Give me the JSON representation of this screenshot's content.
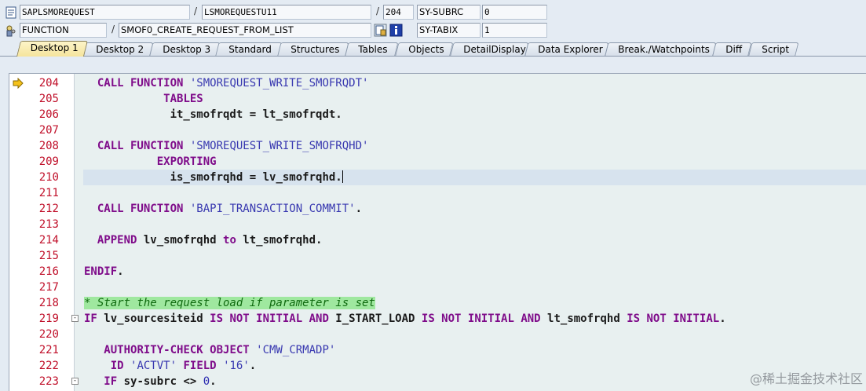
{
  "header": {
    "program": "SAPLSMOREQUEST",
    "include": "LSMOREQUESTU11",
    "line": "204",
    "sy_subrc_label": "SY-SUBRC",
    "sy_subrc_value": "0",
    "event_type": "FUNCTION",
    "event_name": "SMOF0_CREATE_REQUEST_FROM_LIST",
    "sy_tabix_label": "SY-TABIX",
    "sy_tabix_value": "1",
    "separator": "/"
  },
  "tabs": [
    {
      "label": "Desktop 1",
      "active": true
    },
    {
      "label": "Desktop 2"
    },
    {
      "label": "Desktop 3"
    },
    {
      "label": "Standard"
    },
    {
      "label": "Structures"
    },
    {
      "label": "Tables"
    },
    {
      "label": "Objects"
    },
    {
      "label": "DetailDisplay"
    },
    {
      "label": "Data Explorer"
    },
    {
      "label": "Break./Watchpoints"
    },
    {
      "label": "Diff"
    },
    {
      "label": "Script"
    }
  ],
  "editor": {
    "current_line": "204",
    "cursor_line": "210",
    "lines": [
      {
        "n": "204",
        "indent": "  ",
        "parts": [
          [
            "kw",
            "CALL FUNCTION"
          ],
          [
            "id",
            " "
          ],
          [
            "str",
            "'SMOREQUEST_WRITE_SMOFRQDT'"
          ]
        ]
      },
      {
        "n": "205",
        "indent": "            ",
        "parts": [
          [
            "kw",
            "TABLES"
          ]
        ]
      },
      {
        "n": "206",
        "indent": "             ",
        "parts": [
          [
            "id",
            "it_smofrqdt = lt_smofrqdt."
          ]
        ]
      },
      {
        "n": "207",
        "indent": "",
        "parts": []
      },
      {
        "n": "208",
        "indent": "  ",
        "parts": [
          [
            "kw",
            "CALL FUNCTION"
          ],
          [
            "id",
            " "
          ],
          [
            "str",
            "'SMOREQUEST_WRITE_SMOFRQHD'"
          ]
        ]
      },
      {
        "n": "209",
        "indent": "           ",
        "parts": [
          [
            "kw",
            "EXPORTING"
          ]
        ]
      },
      {
        "n": "210",
        "indent": "             ",
        "parts": [
          [
            "id",
            "is_smofrqhd = lv_smofrqhd."
          ]
        ]
      },
      {
        "n": "211",
        "indent": "",
        "parts": []
      },
      {
        "n": "212",
        "indent": "  ",
        "parts": [
          [
            "kw",
            "CALL FUNCTION"
          ],
          [
            "id",
            " "
          ],
          [
            "str",
            "'BAPI_TRANSACTION_COMMIT'"
          ],
          [
            "id",
            "."
          ]
        ]
      },
      {
        "n": "213",
        "indent": "",
        "parts": []
      },
      {
        "n": "214",
        "indent": "  ",
        "parts": [
          [
            "kw",
            "APPEND"
          ],
          [
            "id",
            " lv_smofrqhd "
          ],
          [
            "kw",
            "to"
          ],
          [
            "id",
            " lt_smofrqhd."
          ]
        ]
      },
      {
        "n": "215",
        "indent": "",
        "parts": []
      },
      {
        "n": "216",
        "indent": "",
        "parts": [
          [
            "kw",
            "ENDIF"
          ],
          [
            "id",
            "."
          ]
        ]
      },
      {
        "n": "217",
        "indent": "",
        "parts": []
      },
      {
        "n": "218",
        "indent": "",
        "parts": [
          [
            "cmt",
            "* Start the request load if parameter is set"
          ]
        ]
      },
      {
        "n": "219",
        "indent": "",
        "parts": [
          [
            "kw",
            "IF"
          ],
          [
            "id",
            " lv_sourcesiteid "
          ],
          [
            "kw",
            "IS NOT INITIAL AND"
          ],
          [
            "id",
            " I_START_LOAD "
          ],
          [
            "kw",
            "IS NOT INITIAL AND"
          ],
          [
            "id",
            " lt_smofrqhd "
          ],
          [
            "kw",
            "IS NOT INITIAL"
          ],
          [
            "id",
            "."
          ]
        ]
      },
      {
        "n": "220",
        "indent": "",
        "parts": []
      },
      {
        "n": "221",
        "indent": "   ",
        "parts": [
          [
            "kw",
            "AUTHORITY-CHECK OBJECT"
          ],
          [
            "id",
            " "
          ],
          [
            "str",
            "'CMW_CRMADP'"
          ]
        ]
      },
      {
        "n": "222",
        "indent": "    ",
        "parts": [
          [
            "kw",
            "ID"
          ],
          [
            "id",
            " "
          ],
          [
            "str",
            "'ACTVT'"
          ],
          [
            "id",
            " "
          ],
          [
            "kw",
            "FIELD"
          ],
          [
            "id",
            " "
          ],
          [
            "str",
            "'16'"
          ],
          [
            "id",
            "."
          ]
        ]
      },
      {
        "n": "223",
        "indent": "   ",
        "parts": [
          [
            "kw",
            "IF"
          ],
          [
            "id",
            " sy-subrc <> "
          ],
          [
            "num",
            "0"
          ],
          [
            "id",
            "."
          ]
        ]
      }
    ]
  },
  "watermark": "@稀土掘金技术社区"
}
